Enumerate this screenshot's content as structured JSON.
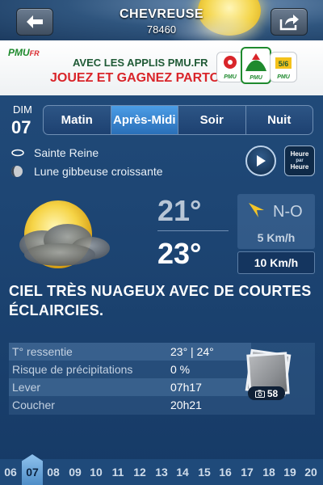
{
  "header": {
    "city": "CHEVREUSE",
    "zip": "78460",
    "back_icon": "back-arrow-icon",
    "share_icon": "share-icon"
  },
  "ad": {
    "logo": "PMU",
    "logo_suffix": "FR",
    "line1": "AVEC LES APPLIS PMU.FR",
    "line2": "JOUEZ ET GAGNEZ PARTOUT",
    "apps": [
      "PMU",
      "PMU",
      "PMU"
    ]
  },
  "day": {
    "name": "DIM",
    "number": "07"
  },
  "tabs": [
    "Matin",
    "Après-Midi",
    "Soir",
    "Nuit"
  ],
  "active_tab": "Après-Midi",
  "saint": "Sainte Reine",
  "moon": "Lune gibbeuse croissante",
  "hourly": {
    "line1": "Heure",
    "line2": "par",
    "line3": "Heure"
  },
  "temps": {
    "low": "21°",
    "high": "23°"
  },
  "wind": {
    "direction": "N-O",
    "speed": "5 Km/h",
    "gust": "10 Km/h"
  },
  "description": "CIEL TRÈS NUAGEUX AVEC DE COURTES ÉCLAIRCIES.",
  "details": [
    {
      "label": "T° ressentie",
      "value": "23° | 24°"
    },
    {
      "label": "Risque de précipitations",
      "value": "0 %"
    },
    {
      "label": "Lever",
      "value": "07h17"
    },
    {
      "label": "Coucher",
      "value": "20h21"
    }
  ],
  "photos": {
    "count": "58",
    "icon": "camera-icon"
  },
  "days": [
    "06",
    "07",
    "08",
    "09",
    "10",
    "11",
    "12",
    "13",
    "14",
    "15",
    "16",
    "17",
    "18",
    "19",
    "20"
  ],
  "selected_day": "07",
  "colors": {
    "accent": "#3a86d0",
    "background": "#1d4573",
    "sun": "#f4d54a"
  }
}
